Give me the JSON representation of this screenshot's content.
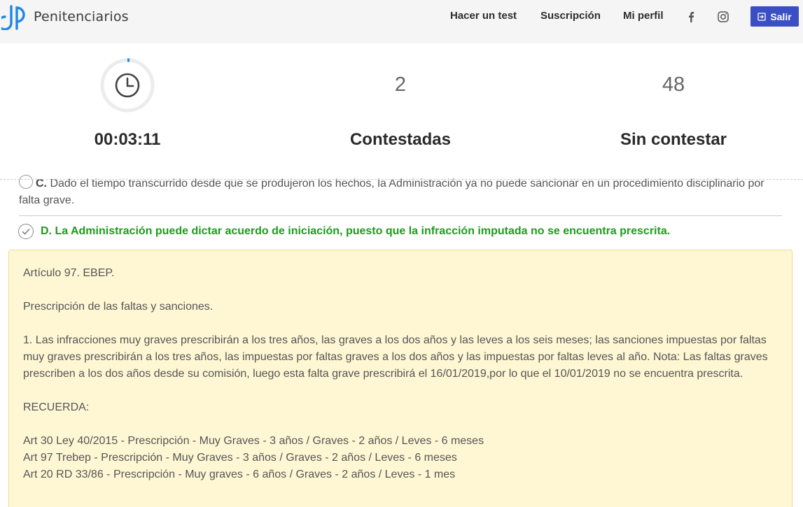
{
  "brand": {
    "name": "Penitenciarios",
    "logo_initials": "dP"
  },
  "nav": {
    "links": [
      "Hacer un test",
      "Suscripción",
      "Mi perfil"
    ],
    "exit_label": "Salir"
  },
  "stats": {
    "timer": "00:03:11",
    "answered_count": "2",
    "answered_label": "Contestadas",
    "unanswered_count": "48",
    "unanswered_label": "Sin contestar"
  },
  "options": {
    "c_letter": "C.",
    "c_text": "Dado el tiempo transcurrido desde que se produjeron los hechos, la Administración ya no puede sancionar en un procedimiento disciplinario por falta grave.",
    "d_text": "D. La Administración puede dictar acuerdo de iniciación, puesto que la infracción imputada no se encuentra prescrita."
  },
  "explanation": {
    "line1": "Artículo 97. EBEP.",
    "line2": "Prescripción de las faltas y sanciones.",
    "paragraph": "1. Las infracciones muy graves prescribirán a los tres años, las graves a los dos años y las leves a los seis meses; las sanciones impuestas por faltas muy graves prescribirán a los tres años, las impuestas por faltas graves a los dos años y las impuestas por faltas leves al año. Nota: Las faltas graves prescriben a los dos años desde su comisión, luego esta falta grave prescribirá el 16/01/2019,por lo que el 10/01/2019 no se encuentra prescrita.",
    "remember": "RECUERDA:",
    "rule1": "Art 30 Ley 40/2015 - Prescripción - Muy Graves - 3 años / Graves - 2 años / Leves - 6 meses",
    "rule2": "Art 97 Trebep - Prescripción - Muy Graves - 3 años / Graves - 2 años / Leves - 6 meses",
    "rule3": "Art 20 RD 33/86 - Prescripción - Muy graves - 6 años / Graves - 2 años / Leves - 1 mes"
  },
  "colors": {
    "accent": "#3b4fc4",
    "correct": "#1f9a1f",
    "explain_bg": "#fff7d4",
    "logo_blue": "#1e88e5"
  },
  "icons": [
    "facebook-icon",
    "instagram-icon",
    "logout-icon",
    "clock-icon",
    "check-icon"
  ]
}
